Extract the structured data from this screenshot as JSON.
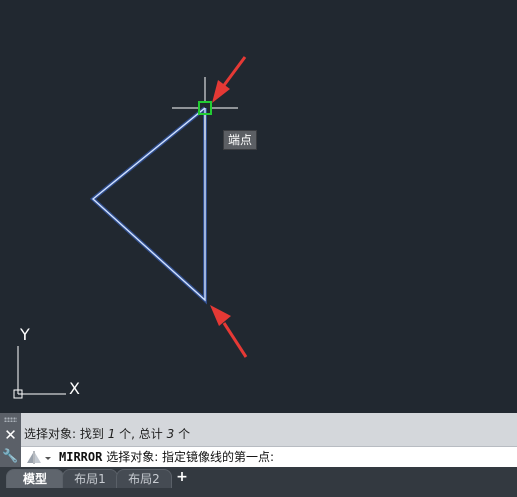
{
  "tooltip": {
    "text": "端点"
  },
  "ucs": {
    "y_label": "Y",
    "x_label": "X"
  },
  "command_line": {
    "history_prefix": "选择对象: 找到",
    "history_count": "1",
    "history_middle": "个, 总计",
    "history_total": "3",
    "history_suffix": "个",
    "command_name": "MIRROR",
    "prompt": "选择对象:  指定镜像线的第一点:"
  },
  "tabs": [
    {
      "label": "模型",
      "active": true
    },
    {
      "label": "布局1",
      "active": false
    },
    {
      "label": "布局2",
      "active": false
    }
  ],
  "add_tab_label": "+",
  "colors": {
    "background": "#212830",
    "geometry": "#9fbfff",
    "snap_marker": "#22cc33",
    "arrow": "#e53935",
    "crosshair": "#ffffff"
  },
  "icons": {
    "close": "close-icon",
    "customize": "wrench-icon",
    "command": "command-prompt-icon"
  }
}
